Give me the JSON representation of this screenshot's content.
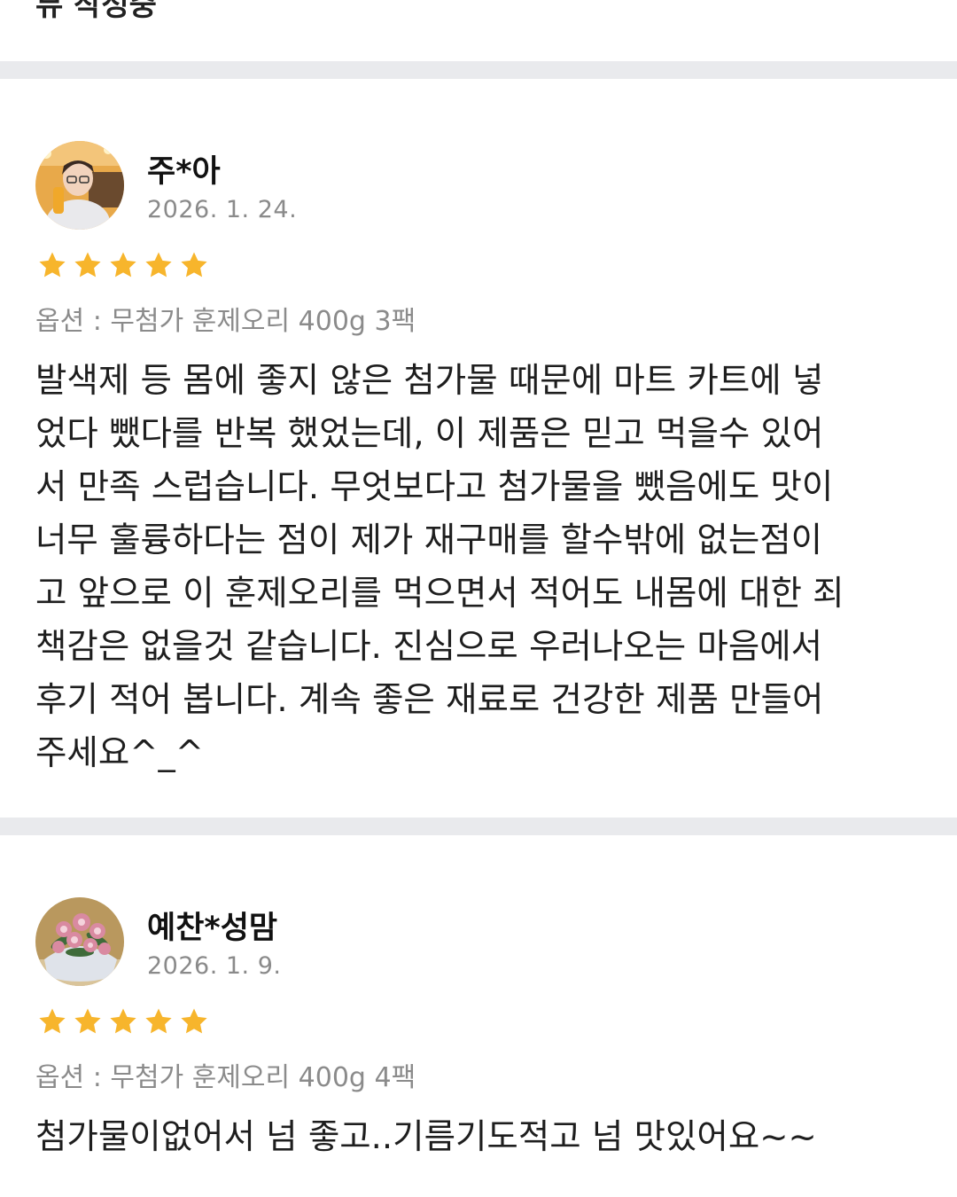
{
  "top_cut_text": "뷰 작성중",
  "reviews": [
    {
      "nickname": "주*아",
      "date": "2026. 1. 24.",
      "rating": 5,
      "option": "옵션 : 무첨가 훈제오리 400g 3팩",
      "body": "발색제 등 몸에 좋지 않은 첨가물 때문에 마트 카트에 넣\n었다 뺐다를 반복 했었는데, 이 제품은 믿고 먹을수 있어\n서 만족 스럽습니다. 무엇보다고 첨가물을 뺐음에도 맛이\n너무 훌륭하다는 점이 제가 재구매를 할수밖에 없는점이\n고 앞으로 이 훈제오리를 먹으면서 적어도 내몸에 대한 죄\n책감은 없을것 같습니다. 진심으로 우러나오는 마음에서\n후기 적어 봅니다. 계속 좋은 재료로 건강한 제품 만들어\n주세요^_^"
    },
    {
      "nickname": "예찬*성맘",
      "date": "2026. 1. 9.",
      "rating": 5,
      "option": "옵션 : 무첨가 훈제오리 400g 4팩",
      "body": "첨가물이없어서 넘 좋고..기름기도적고 넘 맛있어요~~"
    }
  ],
  "colors": {
    "star": "#f7b52c",
    "divider": "#e9eaed",
    "meta_gray": "#8a8a8a"
  },
  "icons": {
    "star": "star-icon"
  }
}
